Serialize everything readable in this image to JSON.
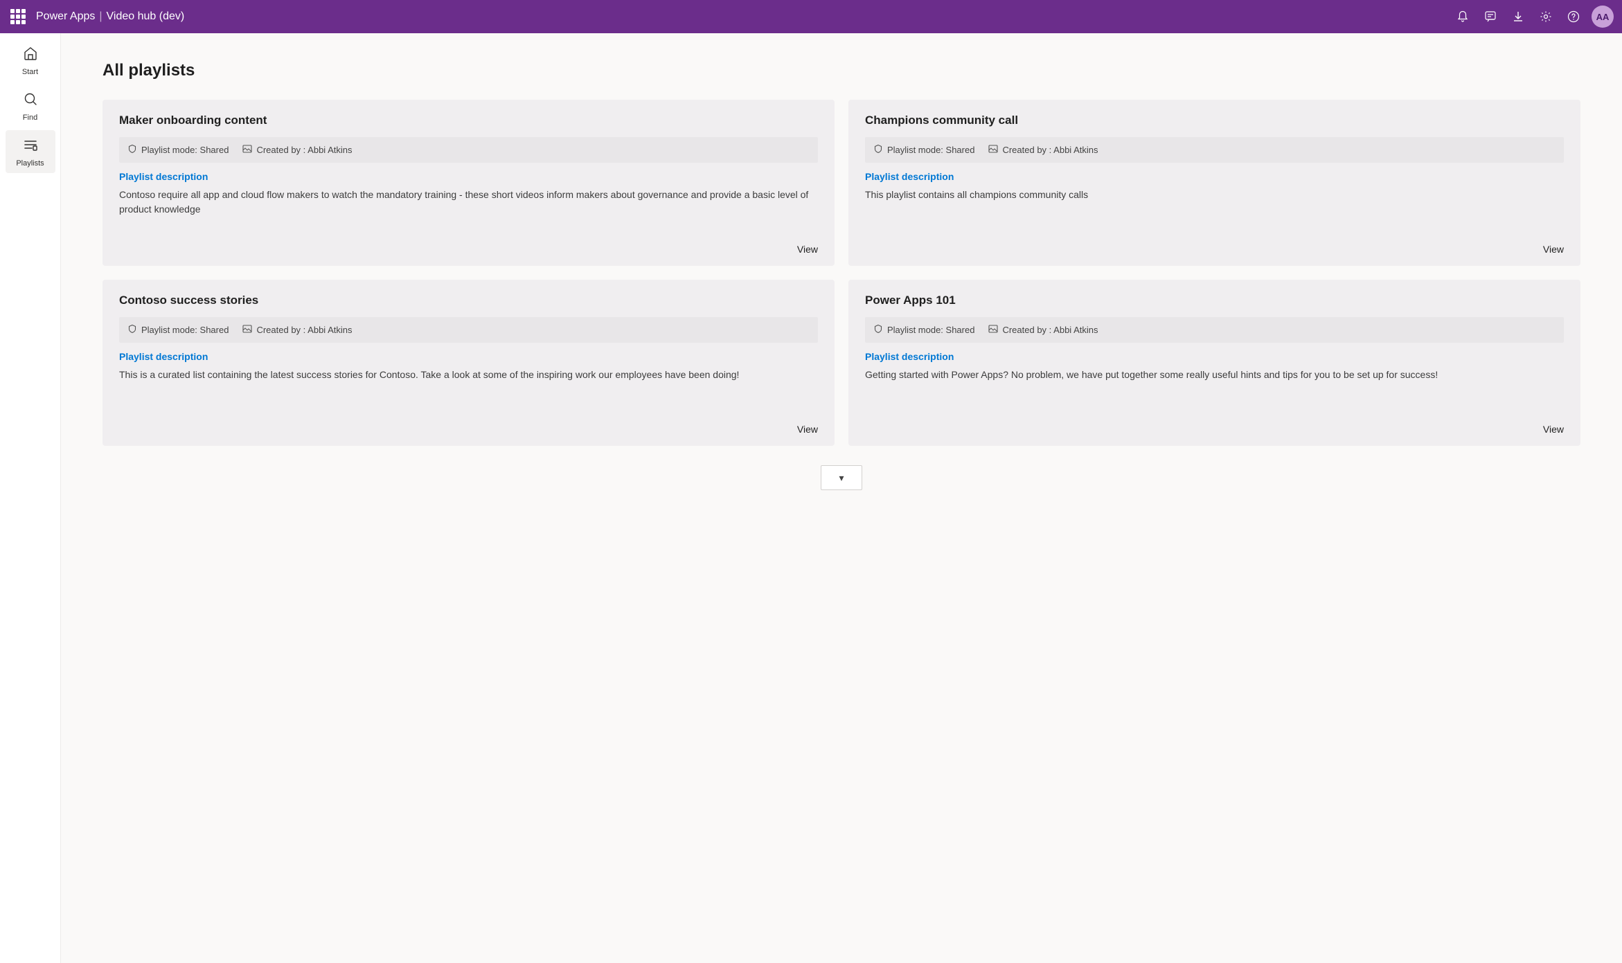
{
  "topbar": {
    "app_name": "Power Apps",
    "separator": "|",
    "subtitle": "Video hub (dev)",
    "icons": {
      "notification": "🔔",
      "comment": "💬",
      "download": "⬇",
      "settings": "⚙",
      "help": "?"
    },
    "avatar_initials": "AA"
  },
  "sidebar": {
    "items": [
      {
        "id": "start",
        "label": "Start",
        "icon": "🏠"
      },
      {
        "id": "find",
        "label": "Find",
        "icon": "🔍"
      },
      {
        "id": "playlists",
        "label": "Playlists",
        "icon": "≡"
      }
    ],
    "active": "playlists"
  },
  "page": {
    "title": "All playlists"
  },
  "playlists": [
    {
      "id": "maker-onboarding",
      "title": "Maker onboarding content",
      "mode": "Playlist mode: Shared",
      "created_by": "Created by : Abbi Atkins",
      "desc_label": "Playlist description",
      "description": "Contoso require all app and cloud flow makers to watch the mandatory training - these short videos inform makers about governance and provide a basic level of product knowledge",
      "view_label": "View"
    },
    {
      "id": "champions-community",
      "title": "Champions community call",
      "mode": "Playlist mode: Shared",
      "created_by": "Created by : Abbi Atkins",
      "desc_label": "Playlist description",
      "description": "This playlist contains all champions community calls",
      "view_label": "View"
    },
    {
      "id": "contoso-success",
      "title": "Contoso success stories",
      "mode": "Playlist mode: Shared",
      "created_by": "Created by : Abbi Atkins",
      "desc_label": "Playlist description",
      "description": "This is a curated list containing the latest success stories for Contoso.  Take a look at some of the inspiring work our employees have been doing!",
      "view_label": "View"
    },
    {
      "id": "power-apps-101",
      "title": "Power Apps 101",
      "mode": "Playlist mode: Shared",
      "created_by": "Created by : Abbi Atkins",
      "desc_label": "Playlist description",
      "description": "Getting started with Power Apps?  No problem, we have put together some really useful hints and tips for you to be set up for success!",
      "view_label": "View"
    }
  ],
  "bottom_chevron": "▾"
}
